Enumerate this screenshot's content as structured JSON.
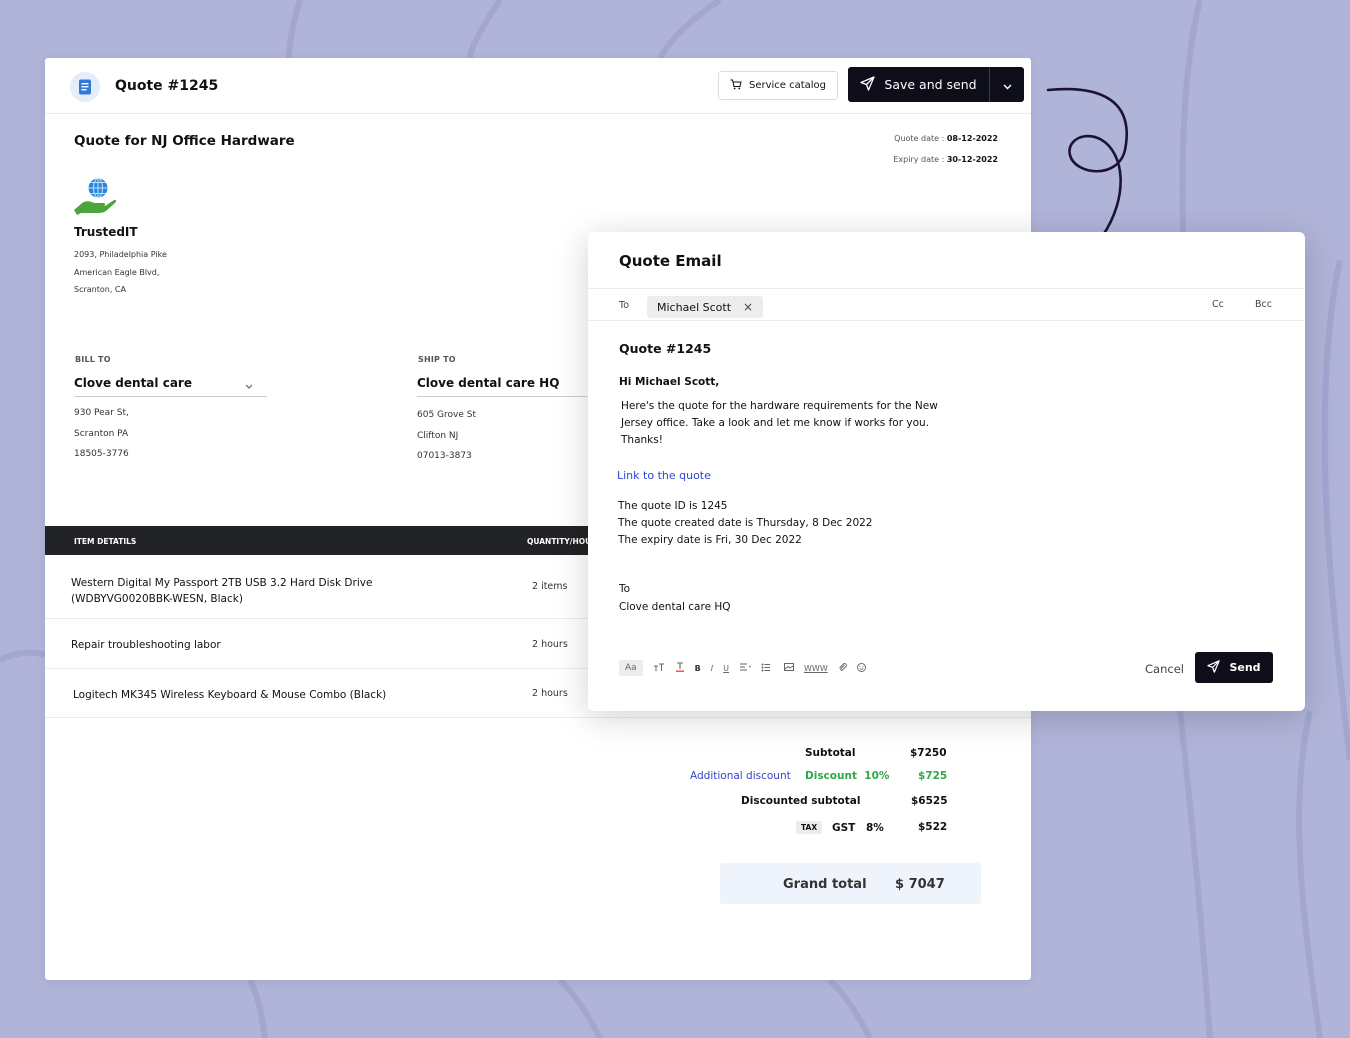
{
  "quote": {
    "number": "Quote #1245",
    "catalog_label": "Service catalog",
    "save_label": "Save and send",
    "quote_for": "Quote for NJ Office Hardware",
    "quote_date_label": "Quote date : ",
    "quote_date": "08-12-2022",
    "expiry_date_label": "Expiry date : ",
    "expiry_date": "30-12-2022"
  },
  "company": {
    "name": "TrustedIT",
    "address": [
      "2093, Philadelphia Pike",
      "American Eagle Blvd,",
      "Scranton, CA"
    ]
  },
  "bill_to": {
    "label": "BILL TO",
    "name": "Clove dental care",
    "address": [
      "930 Pear St,",
      "Scranton PA",
      "18505-3776"
    ]
  },
  "ship_to": {
    "label": "SHIP TO",
    "name": "Clove dental care HQ",
    "address": [
      "605 Grove St",
      "Clifton NJ",
      "07013-3873"
    ]
  },
  "items": {
    "col_details": "ITEM DETATILS",
    "col_qty": "QUANTITY/HOURS",
    "rows": [
      {
        "name": "Western Digital My Passport 2TB USB 3.2 Hard Disk Drive (WDBYVG0020BBK-WESN, Black)",
        "qty": "2 items"
      },
      {
        "name": "Repair troubleshooting labor",
        "qty": "2 hours"
      },
      {
        "name": "Logitech MK345 Wireless Keyboard & Mouse Combo (Black)",
        "qty": "2 hours"
      }
    ]
  },
  "totals": {
    "subtotal_label": "Subtotal",
    "subtotal": "$7250",
    "additional_discount": "Additional discount",
    "discount_label": "Discount",
    "discount_pct": "10%",
    "discount": "$725",
    "discounted_label": "Discounted subtotal",
    "discounted": "$6525",
    "tax_badge": "TAX",
    "tax_name": "GST",
    "tax_pct": "8%",
    "tax": "$522",
    "grand_label": "Grand total",
    "grand": "$ 7047"
  },
  "email": {
    "title": "Quote Email",
    "to_label": "To",
    "recipient": "Michael Scott",
    "cc": "Cc",
    "bcc": "Bcc",
    "subject": "Quote #1245",
    "greeting": "Hi Michael Scott,",
    "body": "Here's the quote for the hardware requirements for the New Jersey office. Take a look and let me know if works for you. Thanks!",
    "link": "Link to the quote",
    "details": [
      "The quote ID is 1245",
      "The quote created date is Thursday, 8 Dec 2022",
      "The expiry date is Fri, 30 Dec 2022"
    ],
    "closing_to": "To",
    "closing_name": "Clove dental care HQ",
    "toolbar_aa": "Aa",
    "toolbar_www": "WWW",
    "cancel": "Cancel",
    "send": "Send"
  },
  "colors": {
    "accent_dark": "#0d0e1a",
    "link_blue": "#2f45d6",
    "discount_green": "#2fa84a",
    "background": "#b1b4d9"
  },
  "icons": [
    "document-icon",
    "cart-icon",
    "send-icon",
    "chevron-down-icon",
    "globe-hand-logo",
    "close-icon"
  ]
}
